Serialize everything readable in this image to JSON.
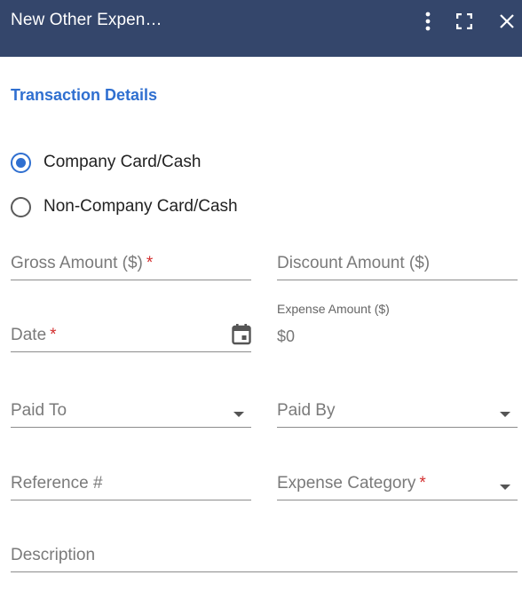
{
  "header": {
    "title": "New Other Expen…",
    "icons": [
      "more-vertical-icon",
      "fullscreen-icon",
      "close-icon"
    ]
  },
  "section": {
    "title": "Transaction Details"
  },
  "payment_type": {
    "options": [
      {
        "label": "Company Card/Cash",
        "selected": true
      },
      {
        "label": "Non-Company Card/Cash",
        "selected": false
      }
    ]
  },
  "fields": {
    "gross_amount": {
      "placeholder": "Gross Amount ($)",
      "required_mark": "*"
    },
    "discount_amount": {
      "placeholder": "Discount Amount ($)"
    },
    "date": {
      "placeholder": "Date",
      "required_mark": "*"
    },
    "expense_amount": {
      "label": "Expense Amount ($)",
      "value": "$0"
    },
    "paid_to": {
      "placeholder": "Paid To"
    },
    "paid_by": {
      "placeholder": "Paid By"
    },
    "reference": {
      "placeholder": "Reference #"
    },
    "expense_category": {
      "placeholder": "Expense Category",
      "required_mark": "*"
    },
    "description": {
      "placeholder": "Description"
    }
  },
  "colors": {
    "header_bg": "#34466b",
    "accent": "#2f6fd0",
    "required": "#d32f2f"
  }
}
